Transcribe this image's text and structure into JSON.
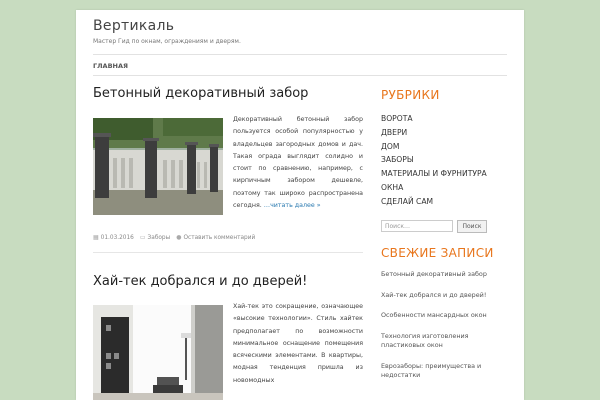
{
  "site": {
    "title": "Вертикаль",
    "description": "Мастер Гид по окнам, ограждениям и дверям."
  },
  "nav": {
    "items": [
      "ГЛАВНАЯ"
    ]
  },
  "posts": [
    {
      "title": "Бетонный декоративный забор",
      "excerpt": "Декоративный бетонный забор пользуется особой популярностью у владельцев загородных домов и дач. Такая ограда выглядит солидно и стоит по сравнению, например, с кирпичным забором дешевле, поэтому так широко распространена сегодня.",
      "read_more": "…читать далее »",
      "date": "01.03.2016",
      "category": "Заборы",
      "comment_link": "Оставить комментарий"
    },
    {
      "title": "Хай-тек добрался и до дверей!",
      "excerpt": "Хай-тек это сокращение, означающее «высокие технологии». Стиль хайтек предполагает по возможности минимальное оснащение помещения всяческими элементами. В квартиры, модная тенденция пришла из новомодных"
    }
  ],
  "sidebar": {
    "categories_title": "РУБРИКИ",
    "categories": [
      "ВОРОТА",
      "ДВЕРИ",
      "ДОМ",
      "ЗАБОРЫ",
      "МАТЕРИАЛЫ И ФУРНИТУРА",
      "ОКНА",
      "СДЕЛАЙ САМ"
    ],
    "search_placeholder": "Поиск…",
    "search_button": "Поиск",
    "recent_title": "СВЕЖИЕ ЗАПИСИ",
    "recent": [
      "Бетонный декоративный забор",
      "Хай-тек добрался и до дверей!",
      "Особенности мансардных окон",
      "Технология изготовления пластиковых окон",
      "Еврозаборы: преимущества и недостатки"
    ]
  },
  "colors": {
    "background": "#c8dcc0",
    "accent": "#e8761d",
    "link": "#2a7ab0"
  }
}
